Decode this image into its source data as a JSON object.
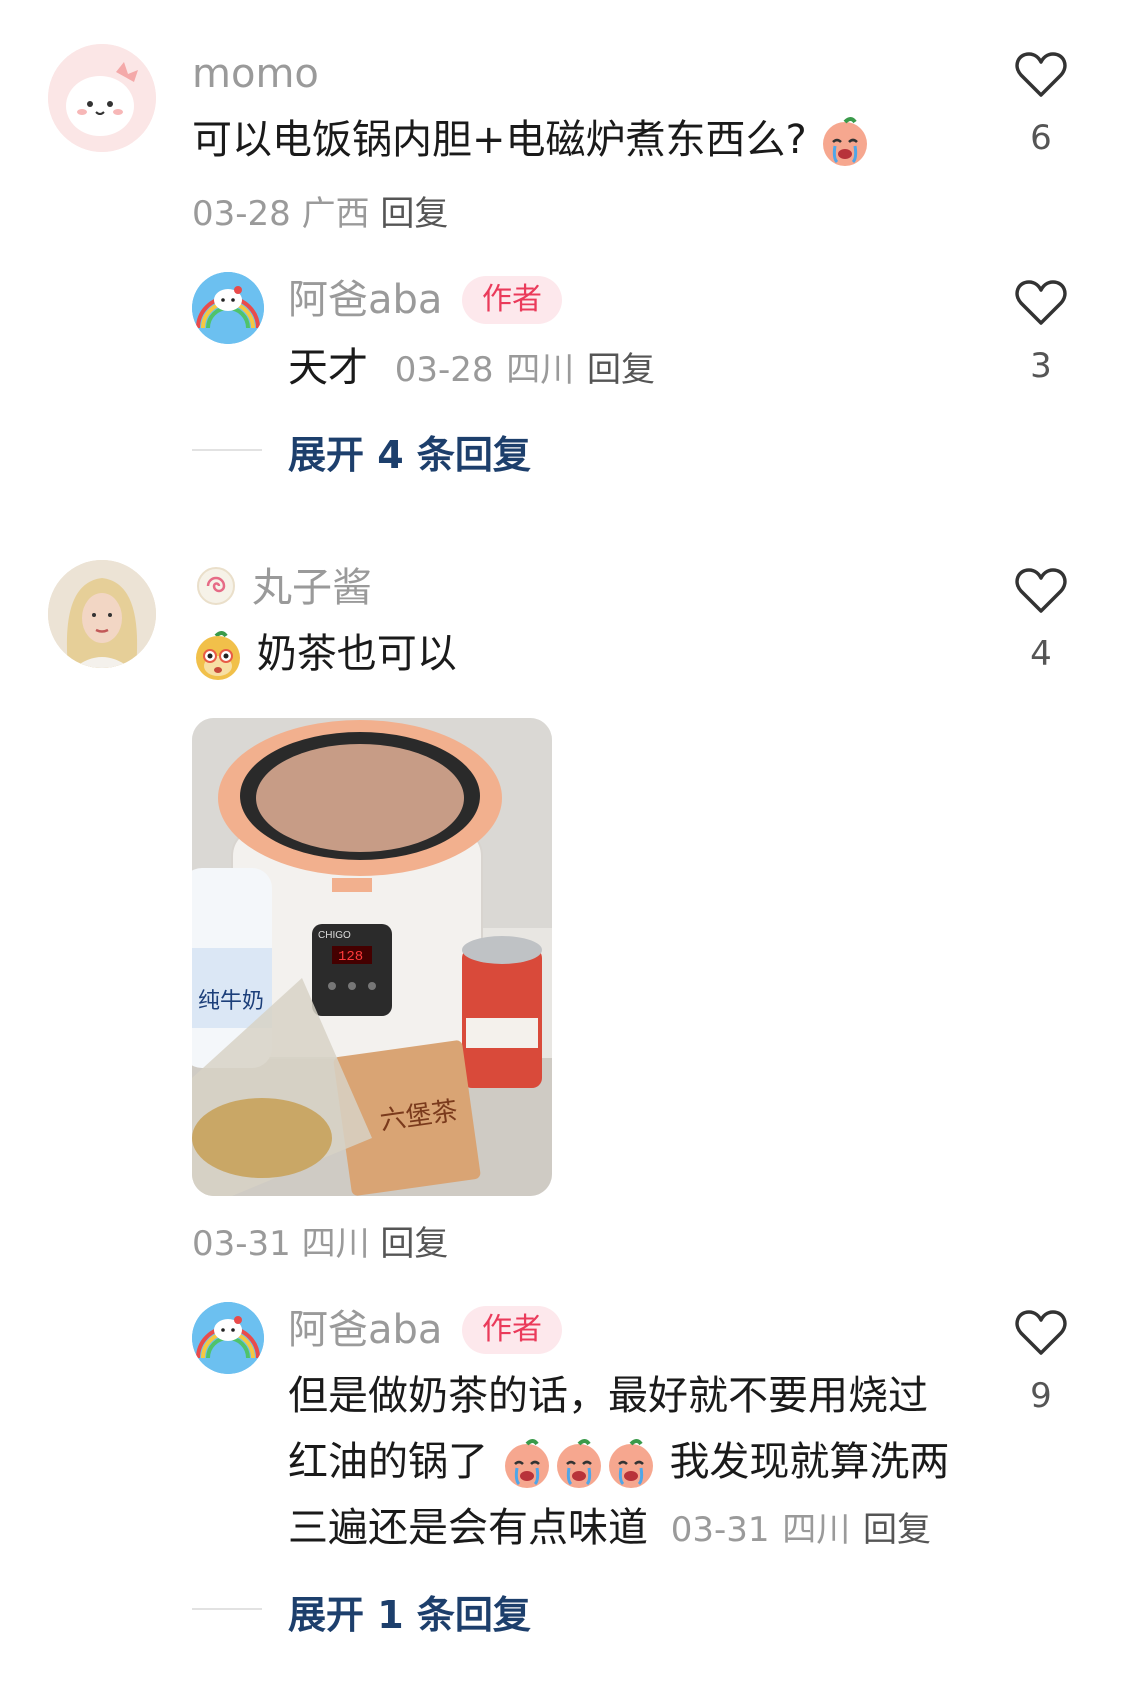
{
  "comments": [
    {
      "username": "momo",
      "text": "可以电饭锅内胆+电磁炉煮东西么?",
      "date": "03-28",
      "location": "广西",
      "reply": "回复",
      "likes": "6",
      "replies": [
        {
          "username": "阿爸aba",
          "badge": "作者",
          "text": "天才",
          "date": "03-28",
          "location": "四川",
          "reply": "回复",
          "likes": "3"
        }
      ],
      "expand": "展开 4 条回复"
    },
    {
      "username": "丸子酱",
      "text": "奶茶也可以",
      "date": "03-31",
      "location": "四川",
      "reply": "回复",
      "likes": "4",
      "photo_labels": [
        "纯牛奶",
        "六堡茶",
        "CHIGO"
      ],
      "photo_display_value": "128",
      "replies": [
        {
          "username": "阿爸aba",
          "badge": "作者",
          "line1": "但是做奶茶的话，最好就不要用烧过",
          "line2a": "红油的锅了",
          "line2b": "我发现就算洗两",
          "line3": "三遍还是会有点味道",
          "date": "03-31",
          "location": "四川",
          "reply": "回复",
          "likes": "9"
        }
      ],
      "expand": "展开 1 条回复"
    }
  ]
}
